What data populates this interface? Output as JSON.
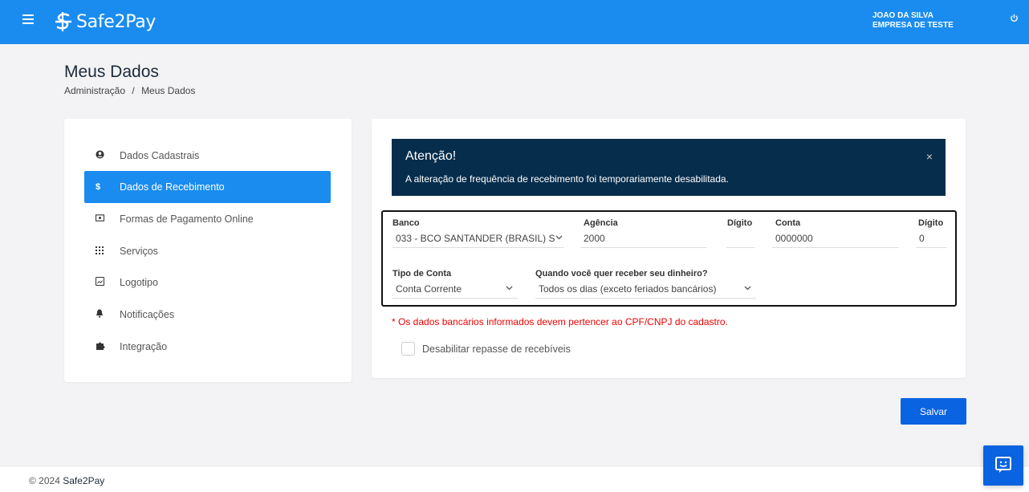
{
  "header": {
    "logo_text": "Safe2Pay",
    "user_name": "JOAO DA SILVA",
    "company_name": "EMPRESA DE TESTE"
  },
  "page": {
    "title": "Meus Dados",
    "breadcrumb_root": "Administração",
    "breadcrumb_sep": "/",
    "breadcrumb_current": "Meus Dados"
  },
  "menu": {
    "items": [
      {
        "label": "Dados Cadastrais",
        "icon": "user-circle-icon"
      },
      {
        "label": "Dados de Recebimento",
        "icon": "dollar-icon",
        "active": true
      },
      {
        "label": "Formas de Pagamento Online",
        "icon": "money-bill-icon"
      },
      {
        "label": "Serviços",
        "icon": "grid-icon"
      },
      {
        "label": "Logotipo",
        "icon": "image-icon"
      },
      {
        "label": "Notificações",
        "icon": "bell-icon"
      },
      {
        "label": "Integração",
        "icon": "puzzle-icon"
      }
    ]
  },
  "alert": {
    "title": "Atenção!",
    "text": "A alteração de frequência de recebimento foi temporariamente desabilitada.",
    "close": "×"
  },
  "bank": {
    "banco_label": "Banco",
    "banco_value": "033 - BCO SANTANDER (BRASIL) S",
    "agencia_label": "Agência",
    "agencia_value": "2000",
    "agencia_digito_label": "Dígito",
    "agencia_digito_value": "",
    "conta_label": "Conta",
    "conta_value": "0000000",
    "conta_digito_label": "Dígito",
    "conta_digito_value": "0",
    "tipo_label": "Tipo de Conta",
    "tipo_value": "Conta Corrente",
    "frequencia_label": "Quando você quer receber seu dinheiro?",
    "frequencia_value": "Todos os dias (exceto feriados bancários)"
  },
  "warning": "* Os dados bancários informados devem pertencer ao CPF/CNPJ do cadastro.",
  "checkbox_label": "Desabilitar repasse de recebíveis",
  "save_label": "Salvar",
  "footer": {
    "copyright": "© 2024",
    "brand": "Safe2Pay"
  },
  "colors": {
    "primary": "#1a8cf0",
    "button": "#0a63e0",
    "alert_bg": "#062d4c",
    "warning": "#e00000"
  }
}
